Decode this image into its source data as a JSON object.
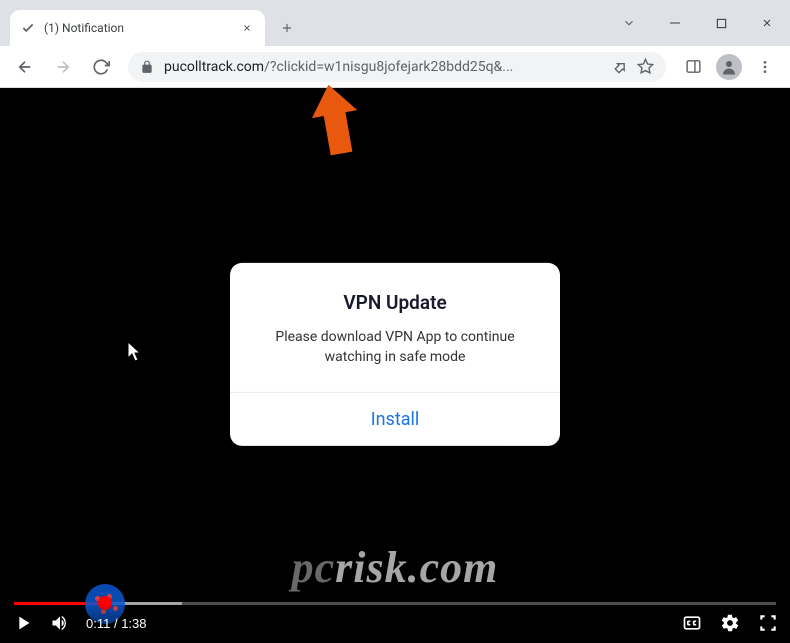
{
  "colors": {
    "accent_red": "#f00",
    "link_blue": "#1a73e8",
    "chrome_bg": "#dee1e6",
    "arrow": "#e8590f"
  },
  "window": {
    "tab_title": "(1) Notification",
    "url_domain": "pucolltrack.com",
    "url_path": "/?clickid=w1nisgu8jofejark28bdd25q&..."
  },
  "modal": {
    "title": "VPN Update",
    "text": "Please download VPN App to continue watching in safe mode",
    "install_label": "Install"
  },
  "player": {
    "current_time": "0:11",
    "duration": "1:38",
    "played_percent": 12,
    "loaded_percent": 22
  },
  "watermark": "pcrisk.com"
}
